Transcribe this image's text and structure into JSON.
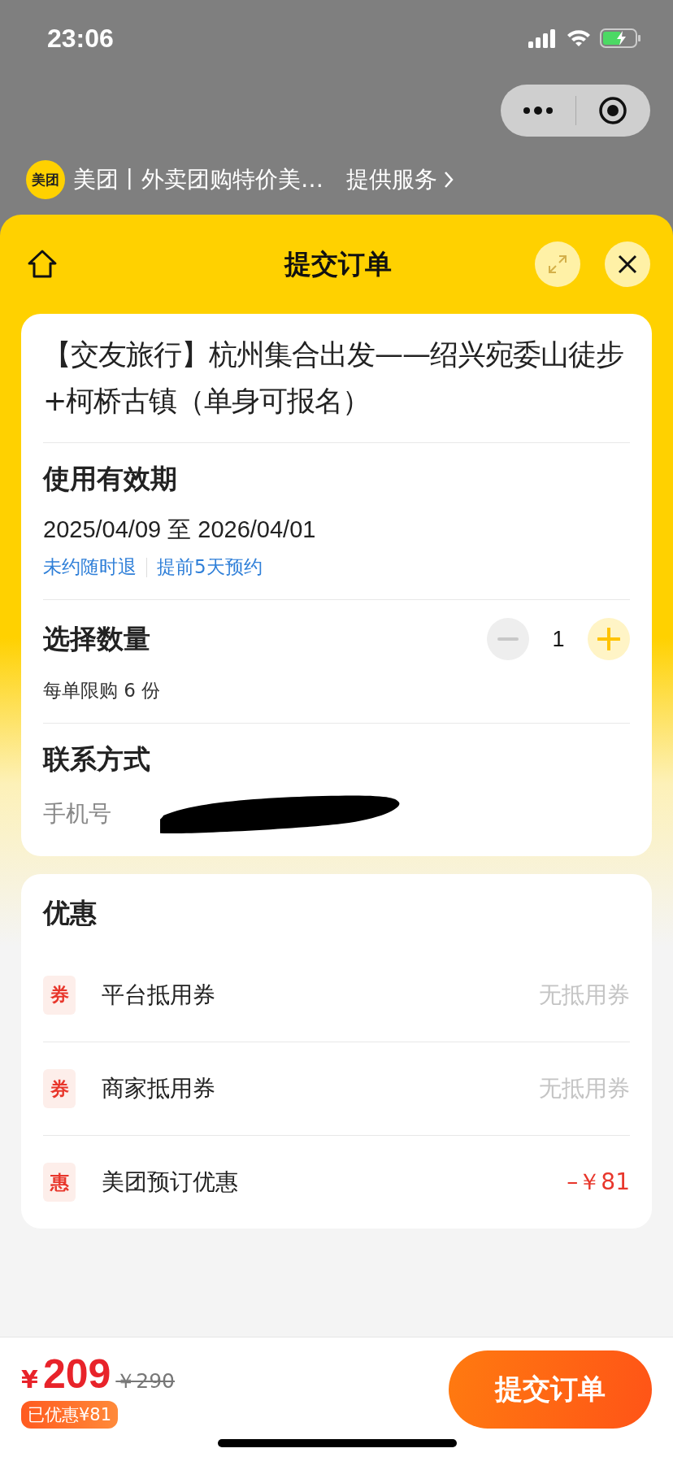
{
  "status_bar": {
    "time": "23:06"
  },
  "provider": {
    "logo": "美团",
    "name": "美团丨外卖团购特价美…",
    "link": "提供服务"
  },
  "sheet": {
    "title": "提交订单"
  },
  "product": {
    "title": "【交友旅行】杭州集合出发——绍兴宛委山徒步+柯桥古镇（单身可报名）"
  },
  "validity": {
    "heading": "使用有效期",
    "dates": "2025/04/09 至 2026/04/01",
    "tags": [
      "未约随时退",
      "提前5天预约"
    ]
  },
  "quantity": {
    "heading": "选择数量",
    "value": "1",
    "limit": "每单限购 6 份",
    "minus_disabled": true,
    "plus_disabled": false
  },
  "contact": {
    "heading": "联系方式",
    "label": "手机号",
    "redacted": true
  },
  "discounts": {
    "heading": "优惠",
    "items": [
      {
        "badge": "券",
        "name": "平台抵用券",
        "value": "无抵用券",
        "kind": "none"
      },
      {
        "badge": "券",
        "name": "商家抵用券",
        "value": "无抵用券",
        "kind": "none"
      },
      {
        "badge": "惠",
        "name": "美团预订优惠",
        "value": "–￥81",
        "kind": "amount"
      }
    ]
  },
  "footer": {
    "currency": "¥",
    "price": "209",
    "original_price": "￥290",
    "saved": "已优惠¥81",
    "submit": "提交订单"
  }
}
